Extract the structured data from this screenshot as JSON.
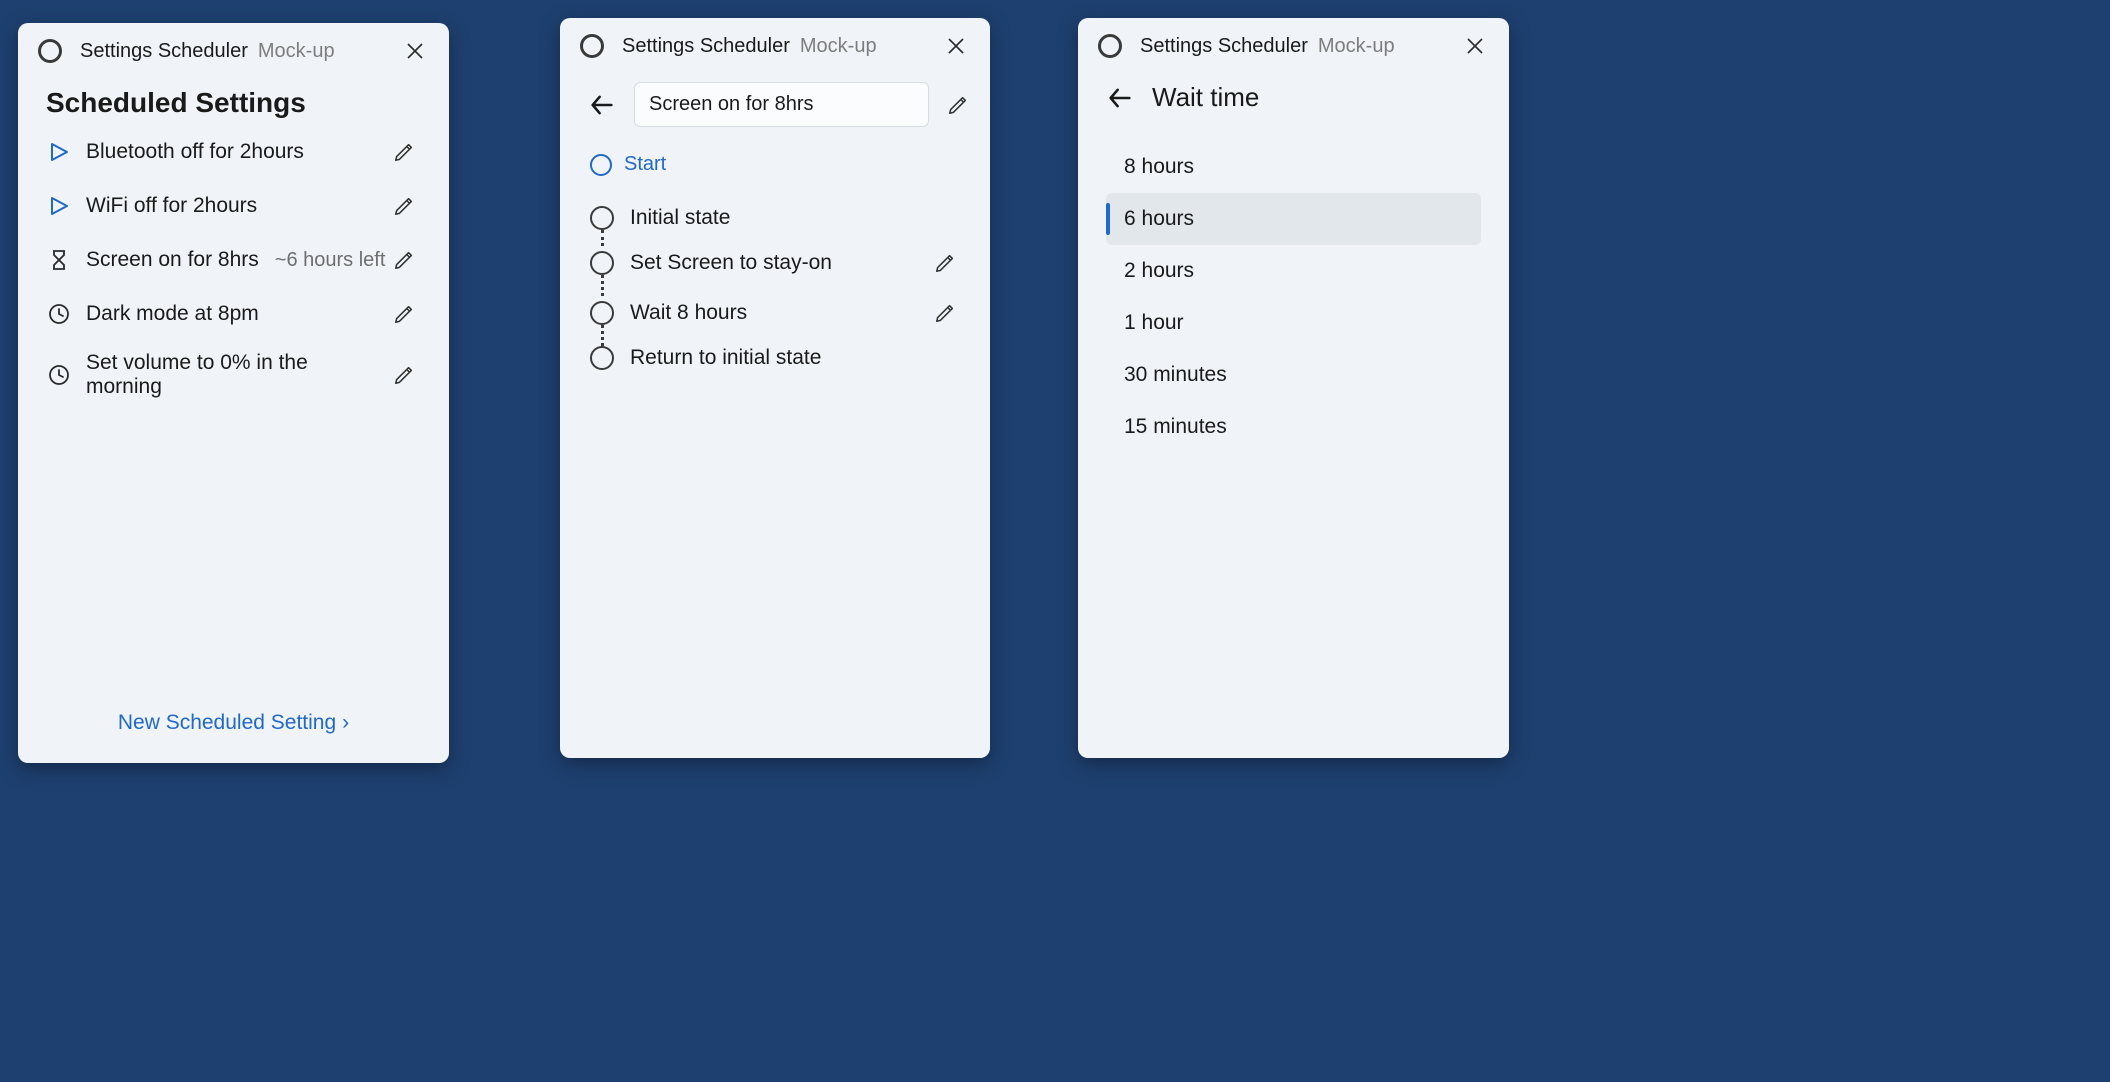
{
  "app": {
    "title": "Settings Scheduler",
    "subtitle": "Mock-up"
  },
  "card1": {
    "heading": "Scheduled Settings",
    "rules": [
      {
        "icon": "play",
        "label": "Bluetooth off for 2hours",
        "meta": ""
      },
      {
        "icon": "play",
        "label": "WiFi off for 2hours",
        "meta": ""
      },
      {
        "icon": "hourglass",
        "label": "Screen on for 8hrs",
        "meta": "~6 hours left"
      },
      {
        "icon": "clock",
        "label": "Dark mode at  8pm",
        "meta": ""
      },
      {
        "icon": "clock",
        "label": "Set volume to 0% in the morning",
        "meta": ""
      }
    ],
    "new_link": "New Scheduled Setting"
  },
  "card2": {
    "title_value": "Screen on for 8hrs",
    "start_label": "Start",
    "steps": [
      {
        "label": "Initial state",
        "editable": false
      },
      {
        "label": "Set Screen to stay-on",
        "editable": true
      },
      {
        "label": "Wait 8 hours",
        "editable": true
      },
      {
        "label": "Return to initial state",
        "editable": false
      }
    ]
  },
  "card3": {
    "page_title": "Wait time",
    "options": [
      {
        "label": "8 hours",
        "selected": false
      },
      {
        "label": "6 hours",
        "selected": true
      },
      {
        "label": "2 hours",
        "selected": false
      },
      {
        "label": "1 hour",
        "selected": false
      },
      {
        "label": "30 minutes",
        "selected": false
      },
      {
        "label": "15 minutes",
        "selected": false
      }
    ]
  }
}
